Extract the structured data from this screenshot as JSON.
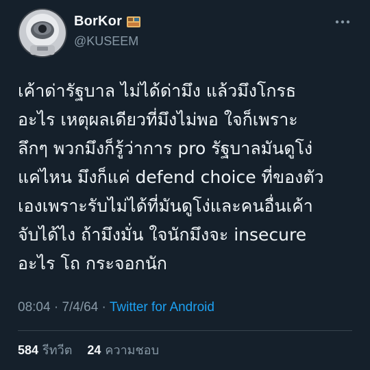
{
  "author": {
    "display_name": "BorKor",
    "handle": "@KUSEEM",
    "avatar_icon": "astronaut-avatar",
    "badge_icon": "emoji-badge-icon"
  },
  "menu": {
    "icon": "more-horizontal-icon"
  },
  "tweet": {
    "lines": [
      "เค้าด่ารัฐบาล ไม่ได้ด่ามึง แล้วมึงโกรธ",
      "อะไร เหตุผลเดียวที่มึงไม่พอ ใจก็เพราะ",
      "ลึกๆ พวกมึงก็รู้ว่าการ pro รัฐบาลมันดูโง่",
      "แค่ไหน มึงก็แค่ defend choice ที่ของตัว",
      "เองเพราะรับไม่ได้ที่มันดูโง่และคนอื่นเค้า",
      "จับได้ไง ถ้ามึงมั่น ใจนักมึงจะ insecure",
      "อะไร โถ กระจอกนัก"
    ]
  },
  "meta": {
    "time": "08:04",
    "separator": "·",
    "date": "7/4/64",
    "source": "Twitter for Android"
  },
  "stats": {
    "retweets_count": "584",
    "retweets_label": "รีทวีต",
    "likes_count": "24",
    "likes_label": "ความชอบ"
  },
  "colors": {
    "background": "#15202b",
    "text": "#e7ecef",
    "muted": "#8899a6",
    "link": "#1da1f2",
    "divider": "#38444d"
  }
}
